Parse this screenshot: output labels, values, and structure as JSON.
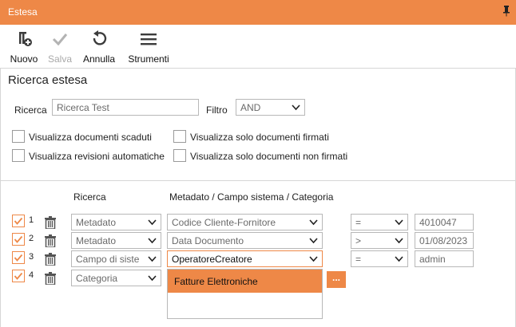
{
  "window": {
    "title": "Estesa"
  },
  "toolbar": {
    "new_label": "Nuovo",
    "save_label": "Salva",
    "undo_label": "Annulla",
    "tools_label": "Strumenti"
  },
  "section": {
    "title": "Ricerca estesa"
  },
  "search": {
    "label": "Ricerca",
    "value": "Ricerca Test",
    "filter_label": "Filtro",
    "filter_value": "AND"
  },
  "options": [
    {
      "label": "Visualizza documenti scaduti",
      "checked": false
    },
    {
      "label": "Visualizza solo documenti firmati",
      "checked": false
    },
    {
      "label": "Visualizza revisioni automatiche",
      "checked": false
    },
    {
      "label": "Visualizza solo documenti non firmati",
      "checked": false
    }
  ],
  "columns": {
    "search": "Ricerca",
    "field": "Metadato / Campo sistema / Categoria"
  },
  "rows": [
    {
      "num": "1",
      "type": "Metadato",
      "field": "Codice Cliente-Fornitore",
      "op": "=",
      "value": "4010047",
      "checked": true
    },
    {
      "num": "2",
      "type": "Metadato",
      "field": "Data Documento",
      "op": ">",
      "value": "01/08/2023",
      "checked": true
    },
    {
      "num": "3",
      "type": "Campo di siste",
      "field": "OperatoreCreatore",
      "op": "=",
      "value": "admin",
      "checked": true
    },
    {
      "num": "4",
      "type": "Categoria",
      "field": "",
      "op": "",
      "value": "",
      "checked": true
    }
  ],
  "category_dropdown": {
    "items": [
      "Fatture Elettroniche"
    ],
    "browse_label": "..."
  },
  "colors": {
    "accent": "#ee8847",
    "border": "#b8b8b8"
  }
}
